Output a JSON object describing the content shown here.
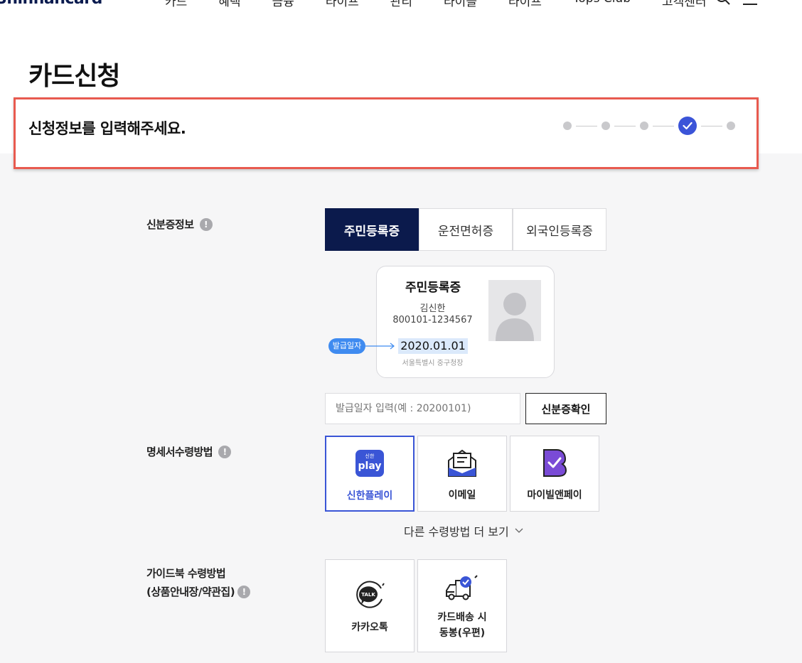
{
  "nav": {
    "logo": "Shinhancard",
    "items": [
      "카드",
      "혜택",
      "금융",
      "라이프",
      "관리",
      "라이블",
      "라이프",
      "Tops Club",
      "고객센터"
    ]
  },
  "page": {
    "title": "카드신청"
  },
  "step": {
    "instruction": "신청정보를 입력해주세요.",
    "total": 5,
    "current": 4
  },
  "id_info": {
    "label": "신분증정보",
    "tabs": [
      "주민등록증",
      "운전면허증",
      "외국인등록증"
    ],
    "selected_tab": "주민등록증",
    "card": {
      "title": "주민등록증",
      "name": "김신한",
      "number": "800101-1234567",
      "issue_date": "2020.01.01",
      "office": "서울특별시 중구청장",
      "badge": "발급일자"
    },
    "date_input_placeholder": "발급일자 입력(예 : 20200101)",
    "confirm_button": "신분증확인"
  },
  "statement": {
    "label": "명세서수령방법",
    "options": [
      {
        "label": "신한플레이",
        "icon": "shinhan-play-icon",
        "selected": true
      },
      {
        "label": "이메일",
        "icon": "email-icon",
        "selected": false
      },
      {
        "label": "마이빌앤페이",
        "icon": "mybill-pay-icon",
        "selected": false
      }
    ],
    "more_link": "다른 수령방법 더 보기"
  },
  "guidebook": {
    "label_line1": "가이드북 수령방법",
    "label_line2": "(상품안내장/약관집)",
    "options": [
      {
        "label": "카카오톡",
        "icon": "kakaotalk-icon"
      },
      {
        "label_line1": "카드배송 시",
        "label_line2": "동봉(우편)",
        "icon": "delivery-truck-icon"
      }
    ]
  },
  "colors": {
    "navy": "#0b1a4c",
    "accent": "#3a55d6",
    "highlight_border": "#e85a4f"
  }
}
